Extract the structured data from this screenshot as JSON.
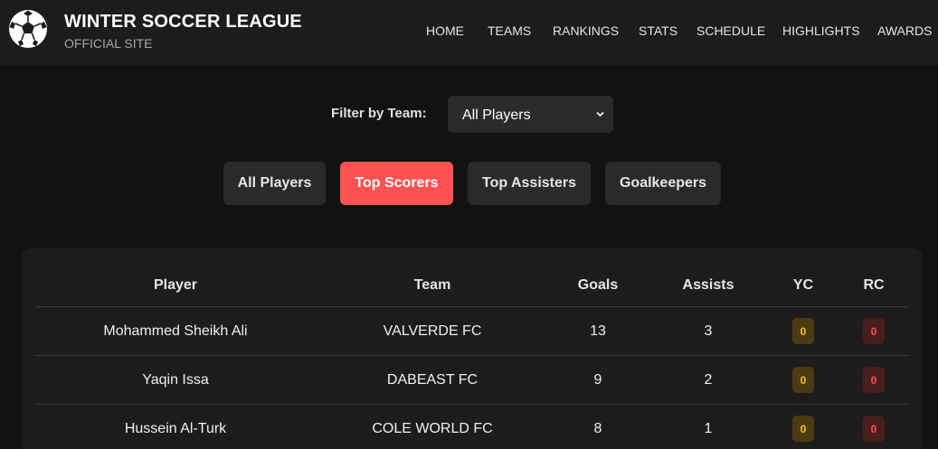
{
  "header": {
    "title": "WINTER SOCCER LEAGUE",
    "subtitle": "OFFICIAL SITE",
    "nav": [
      "HOME",
      "TEAMS",
      "RANKINGS",
      "STATS",
      "SCHEDULE",
      "HIGHLIGHTS",
      "AWARDS"
    ]
  },
  "filter": {
    "label": "Filter by Team:",
    "selected": "All Players"
  },
  "buttons": [
    "All Players",
    "Top Scorers",
    "Top Assisters",
    "Goalkeepers"
  ],
  "active_button": "Top Scorers",
  "table": {
    "columns": [
      "Player",
      "Team",
      "Goals",
      "Assists",
      "YC",
      "RC"
    ],
    "rows": [
      {
        "player": "Mohammed Sheikh Ali",
        "team": "VALVERDE FC",
        "goals": "13",
        "assists": "3",
        "yc": "0",
        "rc": "0"
      },
      {
        "player": "Yaqin Issa",
        "team": "DABEAST FC",
        "goals": "9",
        "assists": "2",
        "yc": "0",
        "rc": "0"
      },
      {
        "player": "Hussein Al-Turk",
        "team": "COLE WORLD FC",
        "goals": "8",
        "assists": "1",
        "yc": "0",
        "rc": "0"
      }
    ]
  },
  "colors": {
    "accent": "#ff5252",
    "yellow_card": "#ffc107",
    "background": "#121212",
    "panel": "#1c1c1c"
  },
  "icons": {
    "logo": "soccer-ball-icon",
    "select": "chevron-down-icon"
  }
}
